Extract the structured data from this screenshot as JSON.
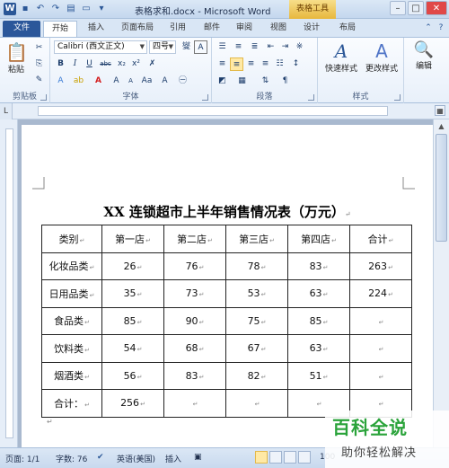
{
  "window": {
    "title": "表格求和.docx - Microsoft Word",
    "context_tab_group": "表格工具",
    "controls": [
      "–",
      "□",
      "✕"
    ]
  },
  "tabs": [
    {
      "label": "文件",
      "kind": "file"
    },
    {
      "label": "开始",
      "kind": "active"
    },
    {
      "label": "插入",
      "kind": "normal"
    },
    {
      "label": "页面布局",
      "kind": "normal"
    },
    {
      "label": "引用",
      "kind": "normal"
    },
    {
      "label": "邮件",
      "kind": "normal"
    },
    {
      "label": "审阅",
      "kind": "normal"
    },
    {
      "label": "视图",
      "kind": "normal"
    },
    {
      "label": "设计",
      "kind": "normal"
    },
    {
      "label": "布局",
      "kind": "normal"
    }
  ],
  "ribbon": {
    "clipboard": {
      "paste_label": "粘贴",
      "group_label": "剪贴板"
    },
    "font": {
      "font_name": "Calibri (西文正文)",
      "font_size": "四号",
      "group_label": "字体",
      "size_up": "A",
      "size_down": "A",
      "aa": "Aa"
    },
    "paragraph": {
      "group_label": "段落"
    },
    "styles": {
      "quick_styles": "快速样式",
      "change_styles": "更改样式",
      "group_label": "样式"
    },
    "editing": {
      "label": "编辑"
    }
  },
  "document": {
    "title": "XX 连锁超市上半年销售情况表（万元）",
    "return_mark": "↵",
    "table": {
      "headers": [
        "类别",
        "第一店",
        "第二店",
        "第三店",
        "第四店",
        "合计"
      ],
      "rows": [
        [
          "化妆品类",
          "26",
          "76",
          "78",
          "83",
          "263"
        ],
        [
          "日用品类",
          "35",
          "73",
          "53",
          "63",
          "224"
        ],
        [
          "食品类",
          "85",
          "90",
          "75",
          "85",
          ""
        ],
        [
          "饮料类",
          "54",
          "68",
          "67",
          "63",
          ""
        ],
        [
          "烟酒类",
          "56",
          "83",
          "82",
          "51",
          ""
        ],
        [
          "合计：",
          "256",
          "",
          "",
          "",
          ""
        ]
      ]
    }
  },
  "statusbar": {
    "page": "页面: 1/1",
    "words": "字数: 76",
    "language": "英语(美国)",
    "insert": "插入",
    "zoom": "100"
  },
  "watermark": {
    "main": "百科全说",
    "sub": "助你轻松解决"
  },
  "colors": {
    "accent": "#2b579a",
    "context_tab": "#e7b73d",
    "watermark_green": "#2aa33a"
  }
}
